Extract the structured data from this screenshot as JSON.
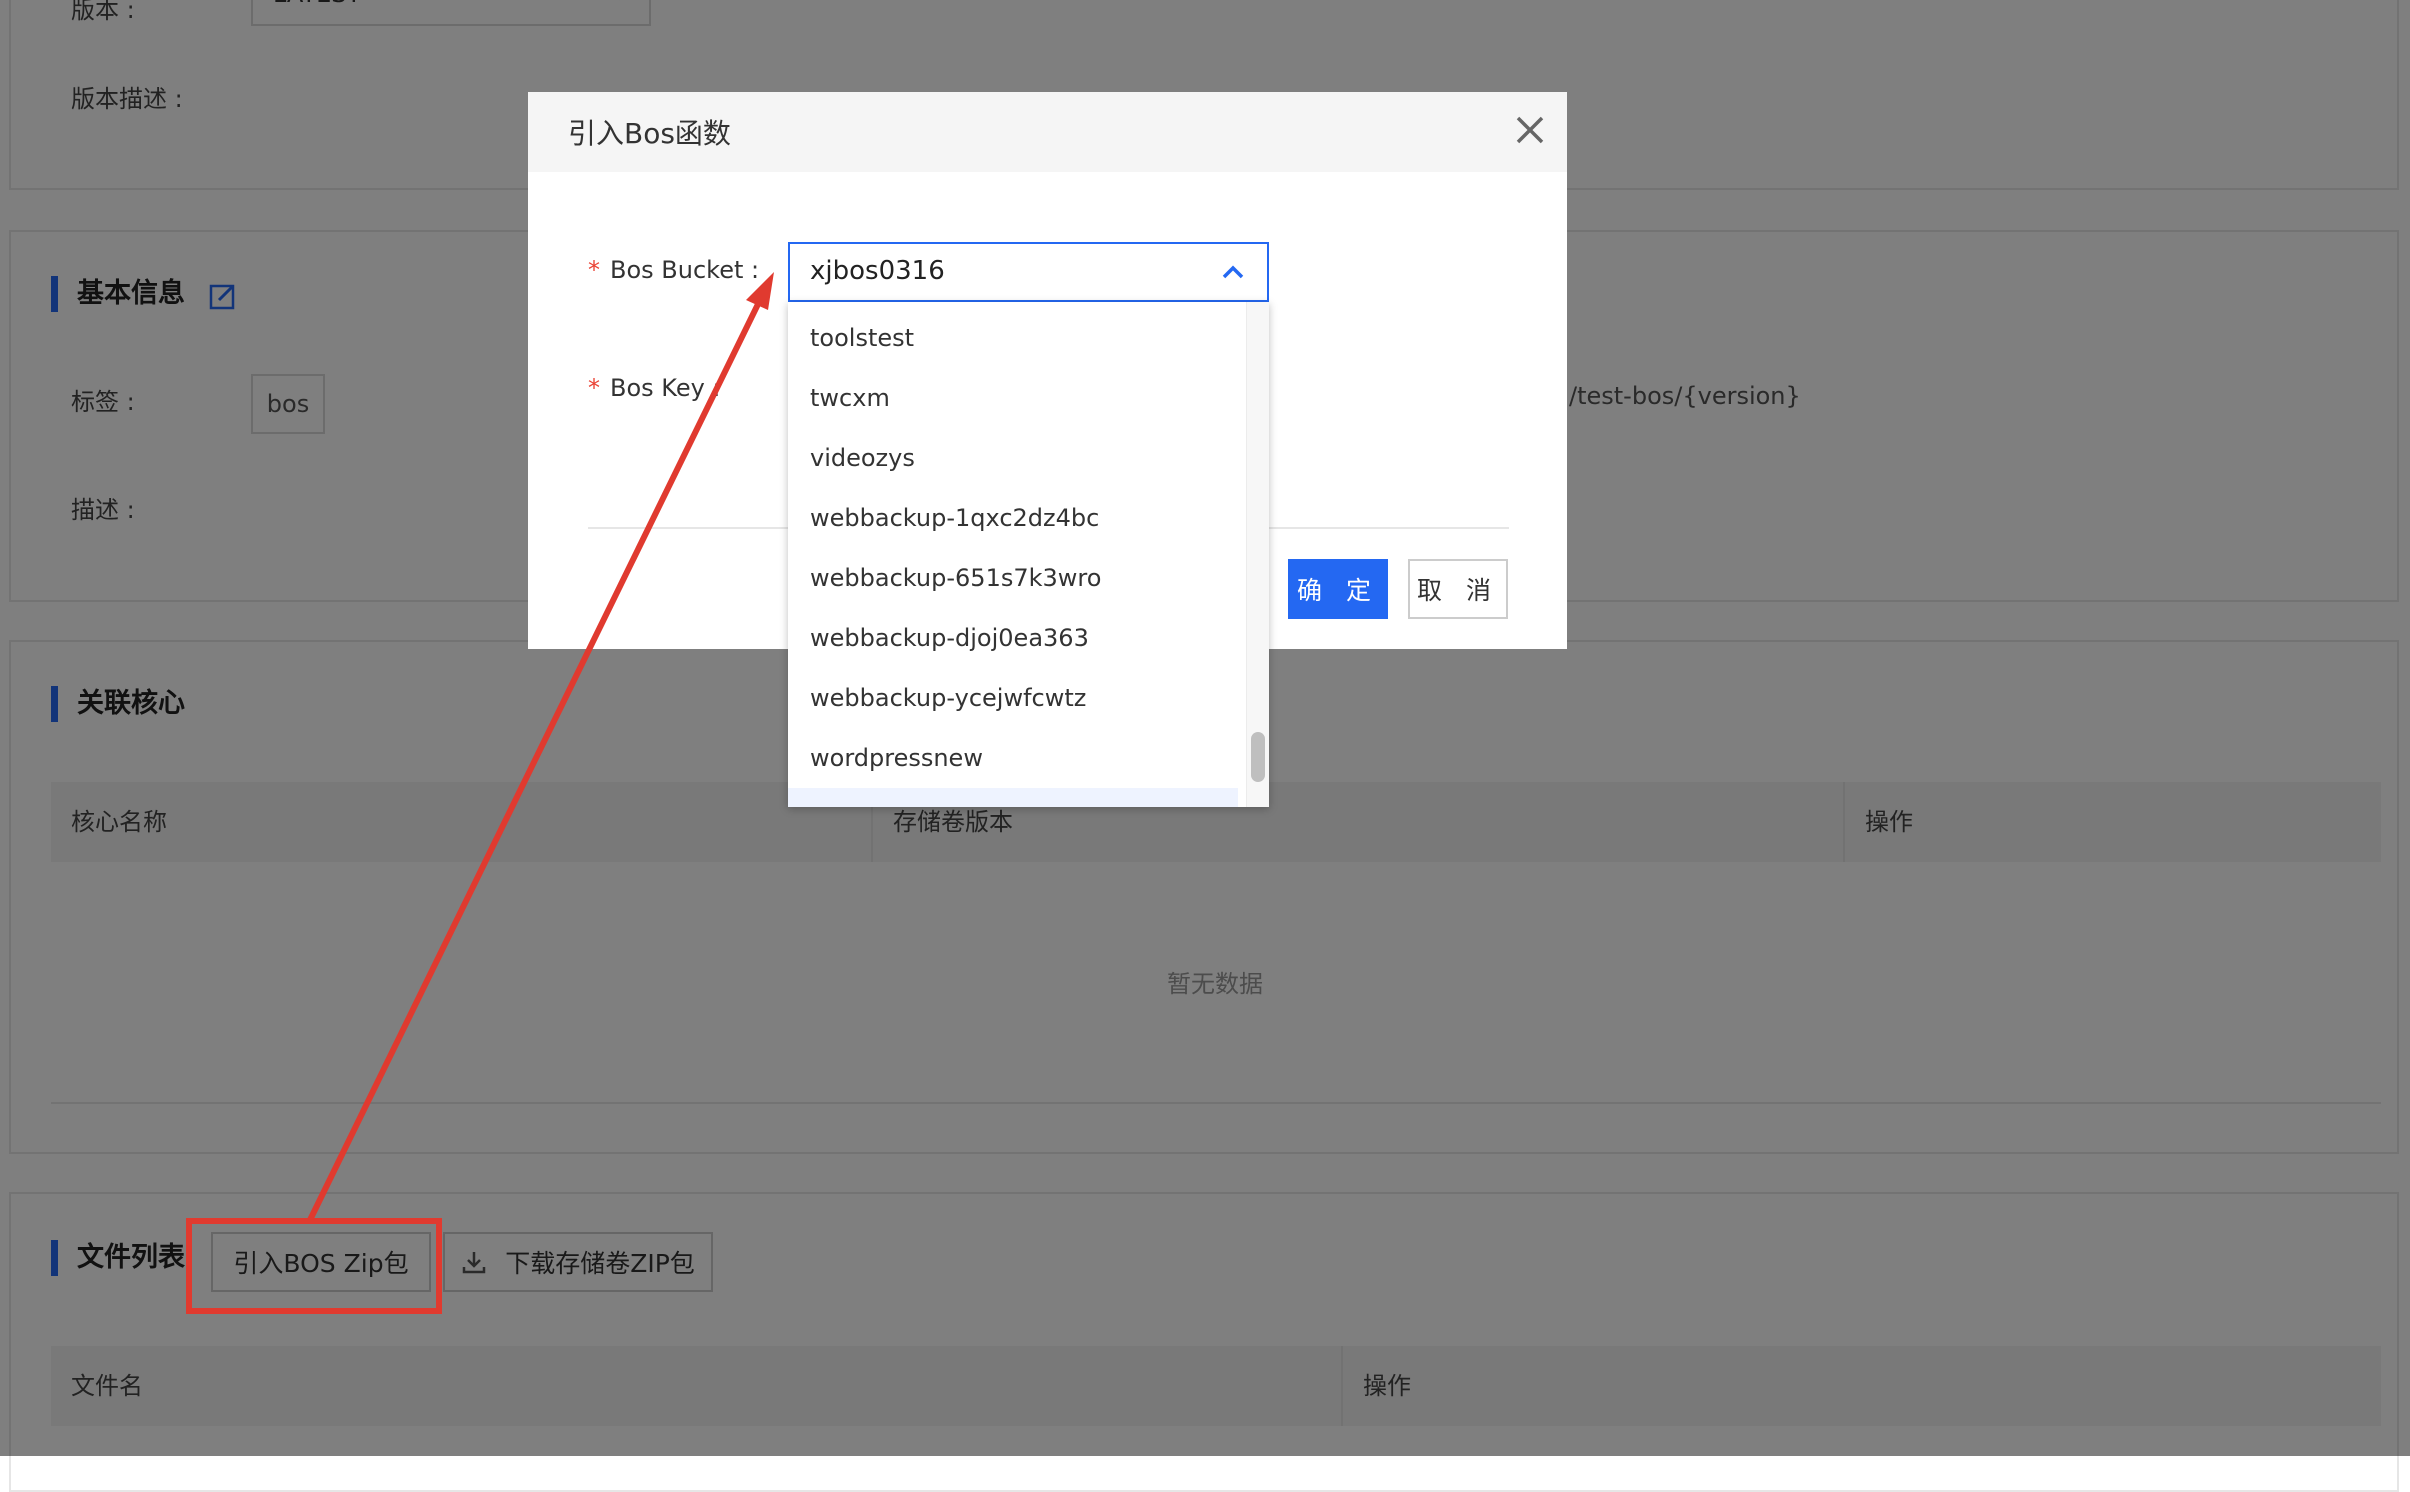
{
  "version_row": {
    "label": "版本 :",
    "value": "LATEST"
  },
  "version_desc": {
    "label": "版本描述 :"
  },
  "basic_info": {
    "title": "基本信息",
    "tags_label": "标签 :",
    "tag_value": "bos",
    "desc_label": "描述 :",
    "path_fragment": "/test-bos/{version}"
  },
  "core_section": {
    "title": "关联核心",
    "columns": [
      "核心名称",
      "存储卷版本",
      "操作"
    ],
    "empty_text": "暂无数据"
  },
  "file_section": {
    "title": "文件列表",
    "import_button": "引入BOS Zip包",
    "download_button": "下载存储卷ZIP包",
    "columns": [
      "文件名",
      "操作"
    ]
  },
  "modal": {
    "title": "引入Bos函数",
    "bucket_label": "Bos Bucket :",
    "bucket_value": "xjbos0316",
    "key_label": "Bos Key :",
    "required_mark": "*",
    "confirm_button": "确 定",
    "cancel_button": "取 消",
    "bucket_options": [
      "toolstest",
      "twcxm",
      "videozys",
      "webbackup-1qxc2dz4bc",
      "webbackup-651s7k3wro",
      "webbackup-djoj0ea363",
      "webbackup-ycejwfcwtz",
      "wordpressnew"
    ]
  },
  "colors": {
    "primary": "#2468f2",
    "annotation": "#e03a2f",
    "overlay": "rgba(0,0,0,0.5)"
  },
  "icons": [
    "edit-icon",
    "close-icon",
    "chevron-up-icon",
    "download-icon",
    "chevron-down-icon"
  ]
}
